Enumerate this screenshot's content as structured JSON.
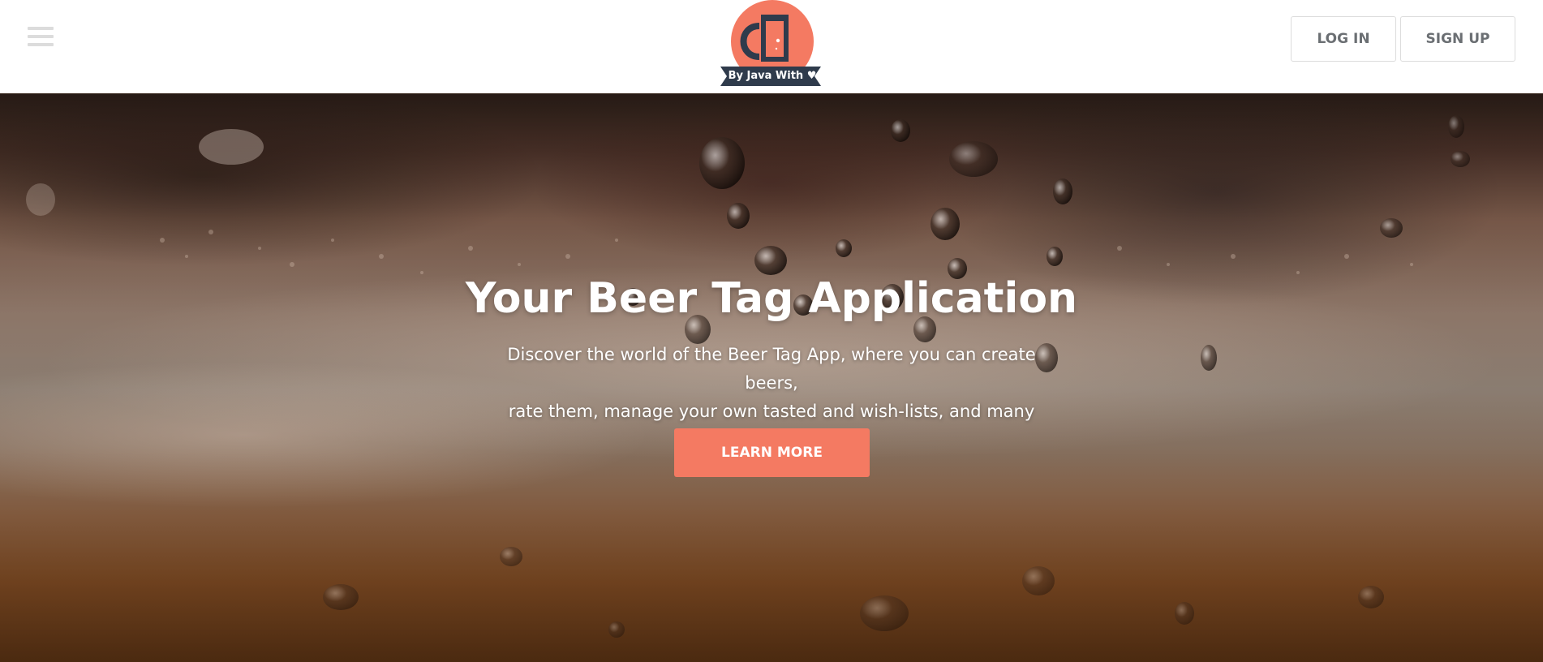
{
  "header": {
    "menu_icon": "hamburger-menu-icon",
    "logo": {
      "text": "By Java With ♥",
      "icon": "beer-tap-logo-icon",
      "colors": {
        "circle": "#f47a62",
        "dark": "#2f3b4c"
      }
    },
    "login_label": "LOG IN",
    "signup_label": "SIGN UP"
  },
  "hero": {
    "title": "Your Beer Tag Application",
    "description_line1": "Discover the world of the Beer Tag App, where you can create beers,",
    "description_line2": "rate them, manage your own tasted and wish-lists, and many more!",
    "cta_label": "LEARN MORE",
    "background": "beer-glass-condensation-photo"
  },
  "colors": {
    "accent": "#f47a62",
    "nav_text": "#6b6f73",
    "nav_border": "#dcdcdc"
  }
}
